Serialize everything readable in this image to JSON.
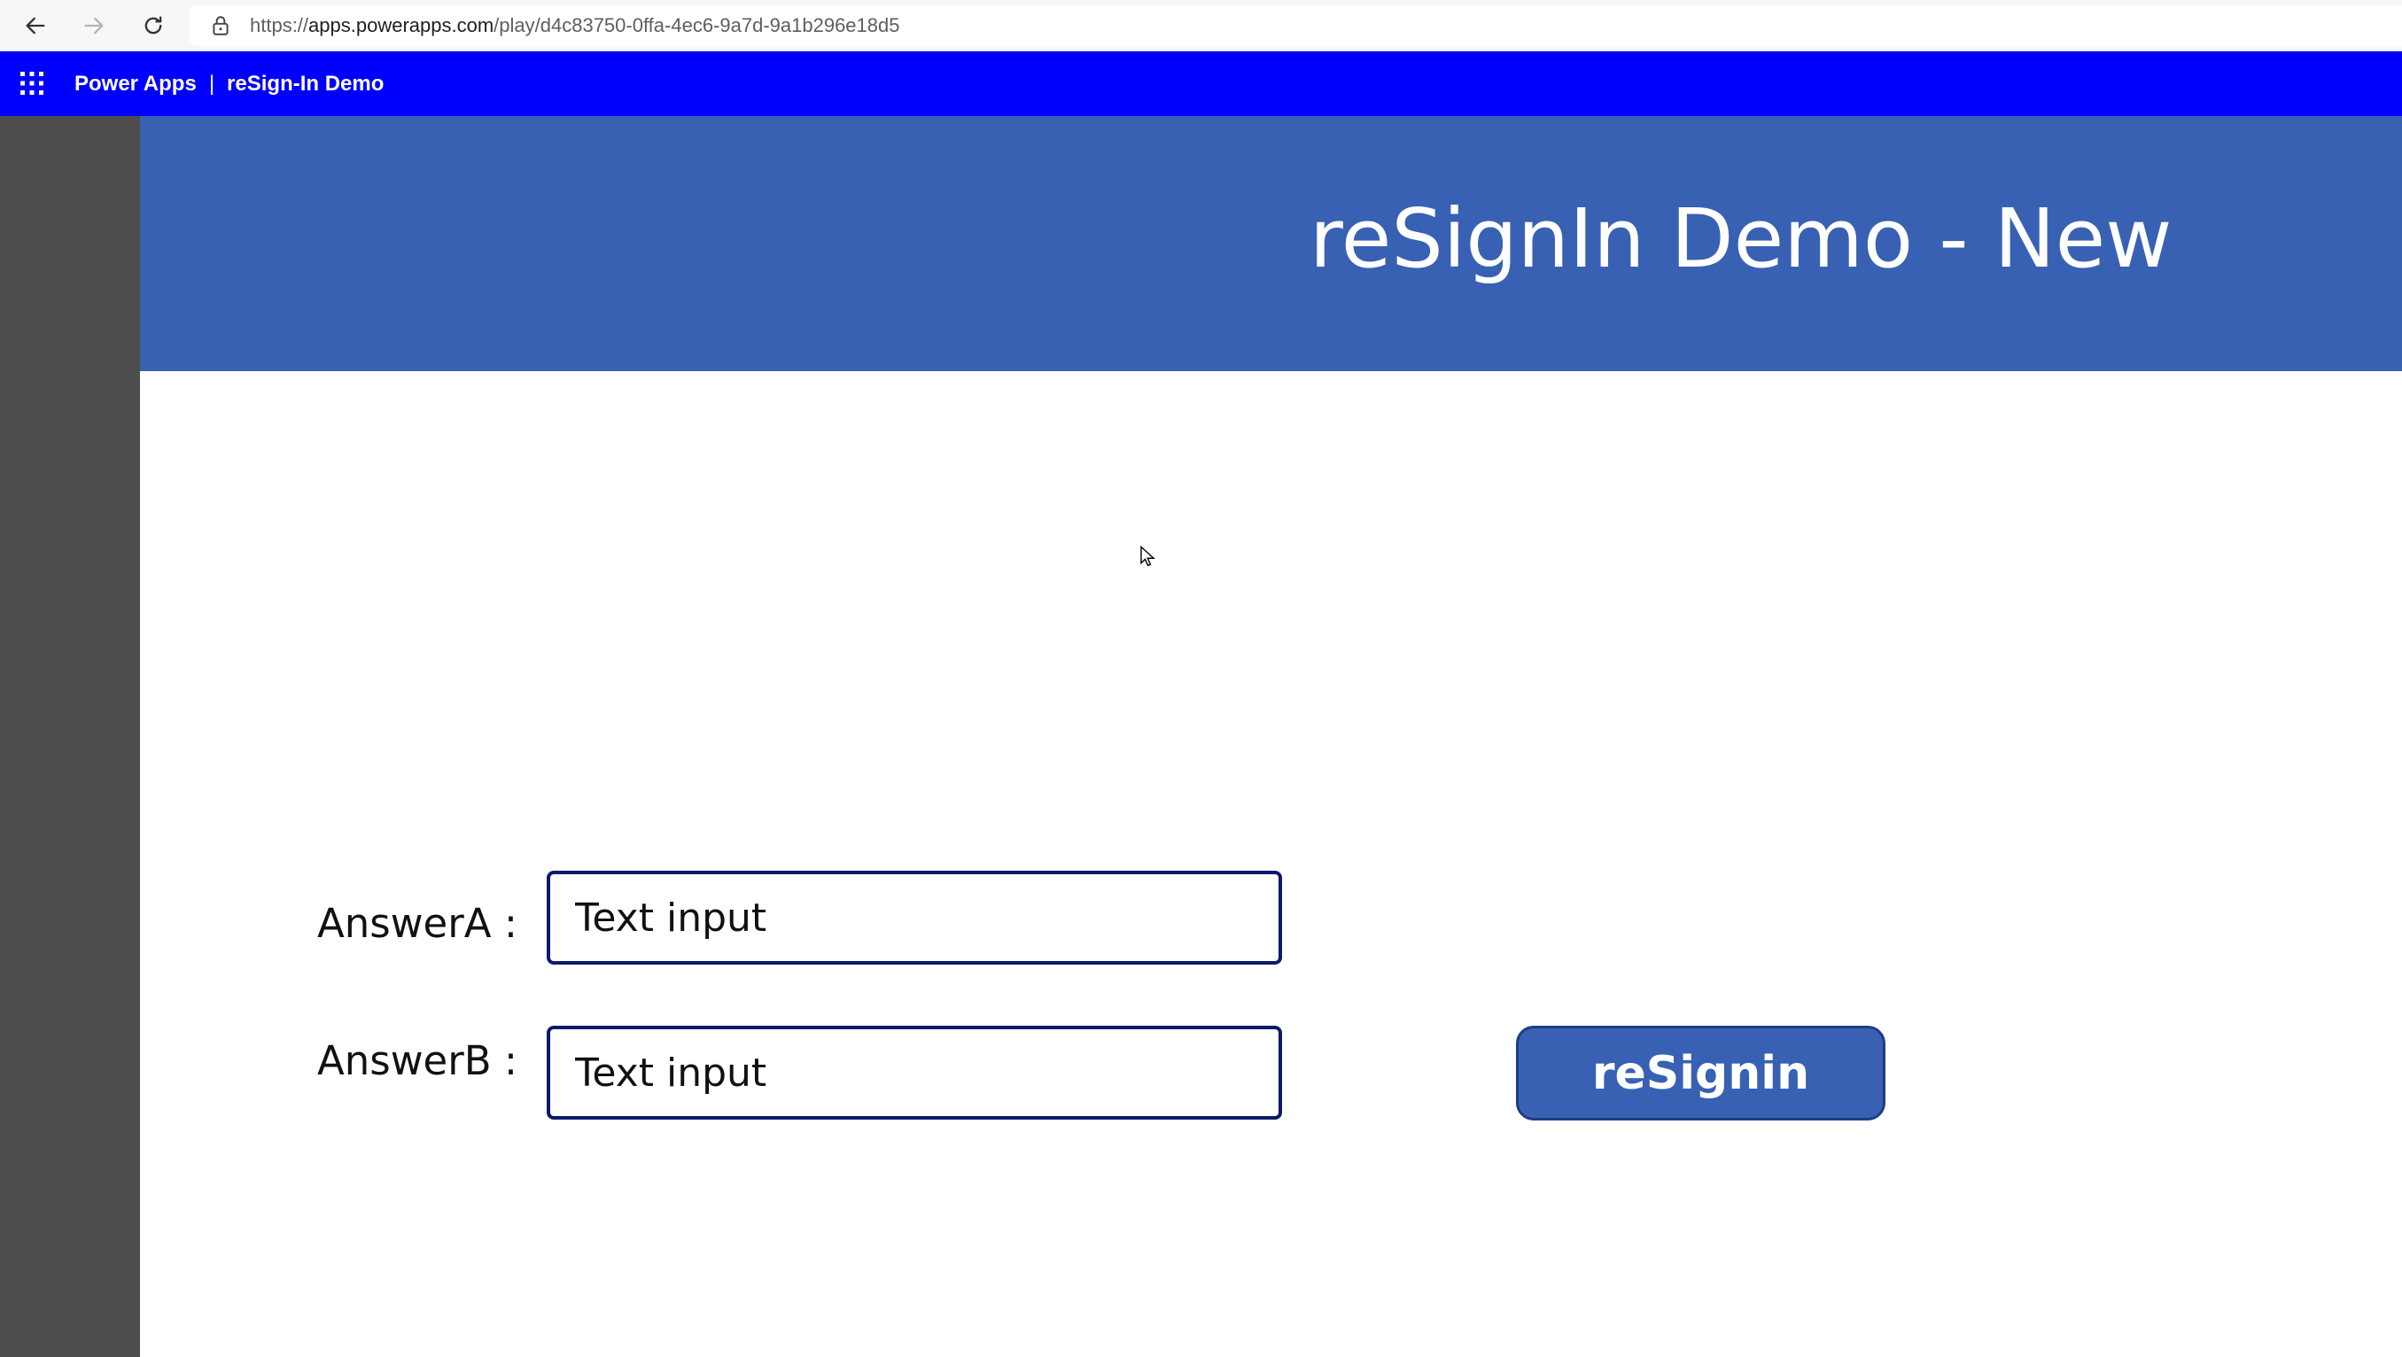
{
  "browser": {
    "url_prefix": "https://",
    "url_domain": "apps.powerapps.com",
    "url_path": "/play/d4c83750-0ffa-4ec6-9a7d-9a1b296e18d5",
    "icons": [
      "back-arrow-icon",
      "forward-arrow-icon",
      "refresh-icon",
      "lock-icon"
    ]
  },
  "app_header": {
    "product": "Power Apps",
    "separator": "|",
    "app_name": "reSign-In Demo",
    "icons": [
      "waffle-icon"
    ]
  },
  "screen": {
    "title": "reSignIn Demo - New",
    "answer_a_label": "AnswerA :",
    "answer_a_placeholder": "Text input",
    "answer_b_label": "AnswerB :",
    "answer_b_placeholder": "Text input",
    "button_label": "reSignin"
  },
  "colors": {
    "header_blue": "#0000ff",
    "banner_blue": "#3861b3",
    "button_blue": "#3861b3",
    "input_border": "#0b1a6b",
    "gutter_gray": "#4d4d4d"
  }
}
